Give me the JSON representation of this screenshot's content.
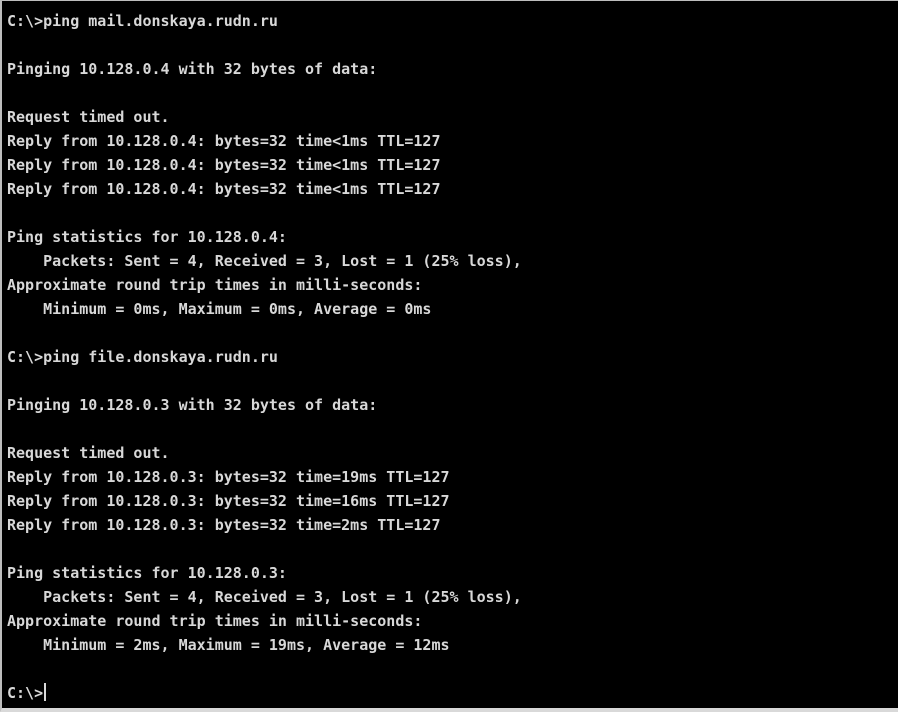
{
  "console": {
    "lines": [
      "C:\\>ping mail.donskaya.rudn.ru",
      "",
      "Pinging 10.128.0.4 with 32 bytes of data:",
      "",
      "Request timed out.",
      "Reply from 10.128.0.4: bytes=32 time<1ms TTL=127",
      "Reply from 10.128.0.4: bytes=32 time<1ms TTL=127",
      "Reply from 10.128.0.4: bytes=32 time<1ms TTL=127",
      "",
      "Ping statistics for 10.128.0.4:",
      "    Packets: Sent = 4, Received = 3, Lost = 1 (25% loss),",
      "Approximate round trip times in milli-seconds:",
      "    Minimum = 0ms, Maximum = 0ms, Average = 0ms",
      "",
      "C:\\>ping file.donskaya.rudn.ru",
      "",
      "Pinging 10.128.0.3 with 32 bytes of data:",
      "",
      "Request timed out.",
      "Reply from 10.128.0.3: bytes=32 time=19ms TTL=127",
      "Reply from 10.128.0.3: bytes=32 time=16ms TTL=127",
      "Reply from 10.128.0.3: bytes=32 time=2ms TTL=127",
      "",
      "Ping statistics for 10.128.0.3:",
      "    Packets: Sent = 4, Received = 3, Lost = 1 (25% loss),",
      "Approximate round trip times in milli-seconds:",
      "    Minimum = 2ms, Maximum = 19ms, Average = 12ms",
      ""
    ],
    "prompt": "C:\\>"
  }
}
